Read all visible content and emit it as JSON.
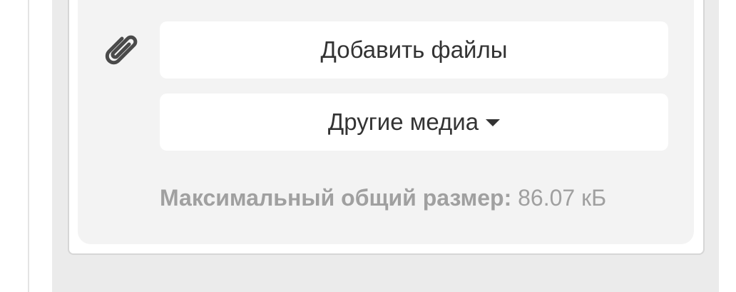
{
  "attachments": {
    "icon": "paperclip-icon",
    "add_files_label": "Добавить файлы",
    "other_media_label": "Другие медиа",
    "max_size_label": "Максимальный общий размер:",
    "max_size_value": "86.07 кБ"
  },
  "colors": {
    "panel_background": "#f3f3f3",
    "button_background": "#ffffff",
    "text": "#333333",
    "muted_text": "#a0a0a0",
    "page_background": "#ebebeb"
  }
}
